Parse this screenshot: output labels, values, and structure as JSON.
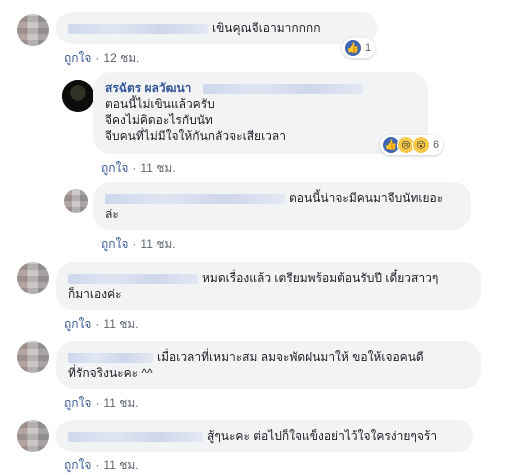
{
  "comments": [
    {
      "text": "เขินคุณจีเอามากกกก",
      "like_label": "ถูกใจ",
      "time": "12 ชม.",
      "reactions": {
        "icons": [
          "like-icon"
        ],
        "count": "1"
      }
    },
    {
      "author": "สรฉัตร ผลวัฒนา",
      "text_lines": [
        "ตอนนี้ไม่เขินแล้วครับ",
        "จีคงไม่คิดอะไรกับนัท",
        "จีบคนที่ไม่มีใจให้กันกลัวจะเสียเวลา"
      ],
      "like_label": "ถูกใจ",
      "time": "11 ชม.",
      "reactions": {
        "icons": [
          "like-icon",
          "sad-icon",
          "wow-icon"
        ],
        "count": "6"
      }
    },
    {
      "text_lines": [
        "ตอนนี้น่าจะมีคนมาจีบนัทเยอะ",
        "ล่ะ"
      ],
      "like_label": "ถูกใจ",
      "time": "11 ชม."
    },
    {
      "text_lines": [
        "หมดเรื่องแล้ว เตรียมพร้อมต้อนรับปี เดี๋ยวสาวๆ",
        "ก็มาเองค่ะ"
      ],
      "like_label": "ถูกใจ",
      "time": "11 ชม."
    },
    {
      "text_lines": [
        "เมื่อเวลาที่เหมาะสม ลมจะพัดฝนมาให้ ขอให้เจอคนดี",
        "ที่รักจริงนะคะ ^^"
      ],
      "like_label": "ถูกใจ",
      "time": "11 ชม."
    },
    {
      "text": "สู้ๆนะคะ ต่อไปก็ใจแข็งอย่าไว้ใจใครง่ายๆจร้า",
      "like_label": "ถูกใจ",
      "time": "11 ชม."
    }
  ]
}
